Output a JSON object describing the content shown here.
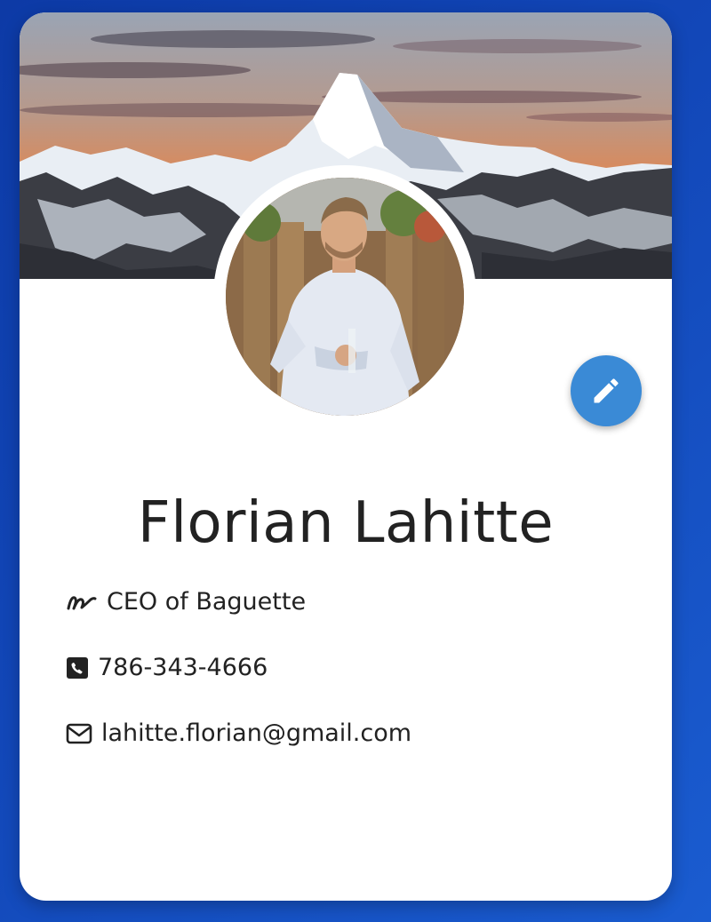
{
  "profile": {
    "name": "Florian Lahitte",
    "title": "CEO of Baguette",
    "phone": "786-343-4666",
    "email": "lahitte.florian@gmail.com"
  },
  "icons": {
    "title": "signature-icon",
    "phone": "phone-square-icon",
    "email": "envelope-icon",
    "edit": "pencil-icon"
  },
  "colors": {
    "background": "#1247b8",
    "card": "#ffffff",
    "edit_button": "#3a8ad6",
    "text": "#222222"
  }
}
